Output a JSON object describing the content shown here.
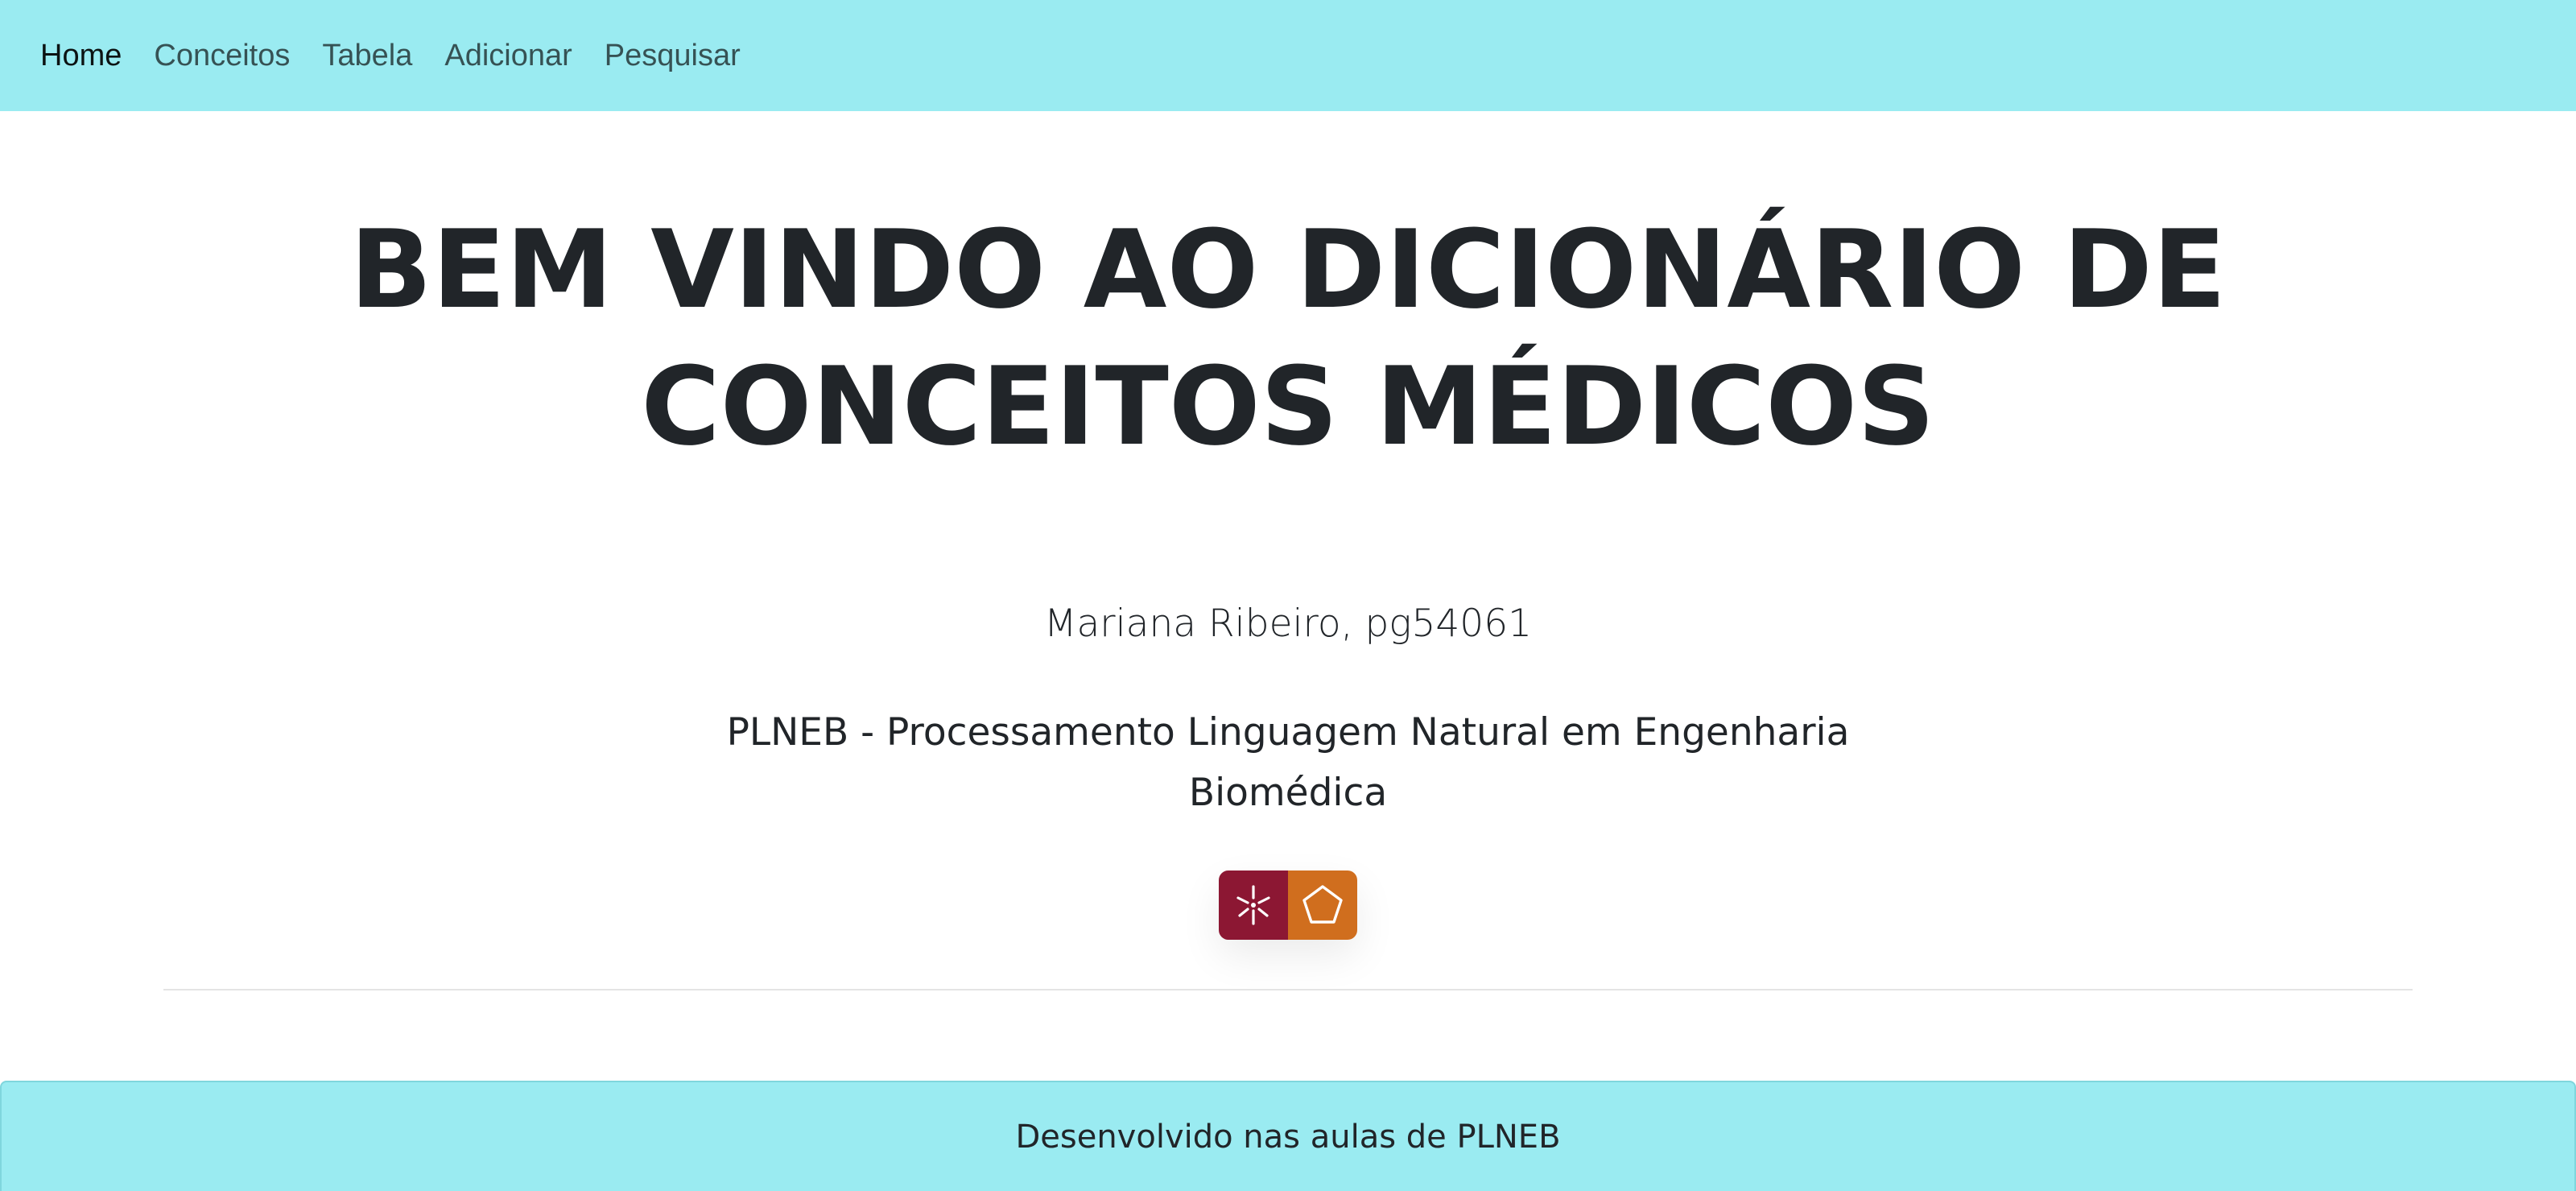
{
  "nav": {
    "items": [
      {
        "label": "Home",
        "active": true
      },
      {
        "label": "Conceitos",
        "active": false
      },
      {
        "label": "Tabela",
        "active": false
      },
      {
        "label": "Adicionar",
        "active": false
      },
      {
        "label": "Pesquisar",
        "active": false
      }
    ]
  },
  "hero": {
    "title_line1": "BEM VINDO AO DICIONÁRIO DE",
    "title_line2": "CONCEITOS MÉDICOS",
    "author": "Mariana Ribeiro, pg54061",
    "course_line1": "PLNEB - Processamento Linguagem Natural em Engenharia",
    "course_line2": "Biomédica"
  },
  "logos": {
    "left_icon": "university-minho-icon",
    "right_icon": "engineering-school-icon",
    "left_color": "#8c1733",
    "right_color": "#d06e1e"
  },
  "footer": {
    "text": "Desenvolvido nas aulas de PLNEB"
  },
  "colors": {
    "nav_bg": "#9aebf1",
    "text": "#212529"
  }
}
